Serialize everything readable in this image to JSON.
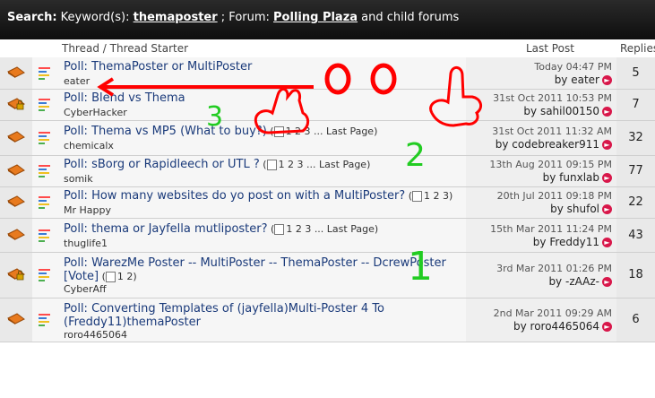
{
  "search": {
    "label": "Search:",
    "keyword_prefix": " Keyword(s): ",
    "keyword": "themaposter",
    "forum_prefix": " ; Forum: ",
    "forum": "Polling Plaza",
    "forum_suffix": " and child forums"
  },
  "columns": {
    "thread": "Thread / Thread Starter",
    "last_post": "Last Post",
    "replies": "Replies"
  },
  "threads": [
    {
      "title": "Poll: ThemaPoster or MultiPoster",
      "pages": "",
      "starter": "eater",
      "date": "Today 04:47 PM",
      "by_prefix": "by ",
      "by": "eater",
      "replies": "5",
      "icon": "closed-dark"
    },
    {
      "title": "Poll: Blend vs Thema",
      "pages": "",
      "starter": "CyberHacker",
      "date": "31st Oct 2011 10:53 PM",
      "by_prefix": "by ",
      "by": "sahil00150",
      "replies": "7",
      "icon": "closed-dark-lock"
    },
    {
      "title": "Poll: Thema vs MP5 (What to buy?)",
      "pages": "1 2 3 ... Last Page",
      "starter": "chemicalx",
      "date": "31st Oct 2011 11:32 AM",
      "by_prefix": "by ",
      "by": "codebreaker911",
      "replies": "32",
      "icon": "hot"
    },
    {
      "title": "Poll: sBorg or Rapidleech or UTL ?",
      "pages": "1 2 3 ... Last Page",
      "starter": "somik",
      "date": "13th Aug 2011 09:15 PM",
      "by_prefix": "by ",
      "by": "funxlab",
      "replies": "77",
      "icon": "hot"
    },
    {
      "title": "Poll: How many websites do yo post on with a MultiPoster?",
      "pages": "1 2 3",
      "starter": "Mr Happy",
      "date": "20th Jul 2011 09:18 PM",
      "by_prefix": "by ",
      "by": "shufol",
      "replies": "22",
      "icon": "hot"
    },
    {
      "title": "Poll: thema or Jayfella mutliposter?",
      "pages": "1 2 3 ... Last Page",
      "starter": "thuglife1",
      "date": "15th Mar 2011 11:24 PM",
      "by_prefix": "by ",
      "by": "Freddy11",
      "replies": "43",
      "icon": "hot"
    },
    {
      "title": "Poll: WarezMe Poster -- MultiPoster -- ThemaPoster -- DcrewPoster",
      "title2": "[Vote]",
      "pages": "1 2",
      "starter": "CyberAff",
      "date": "3rd Mar 2011 01:26 PM",
      "by_prefix": "by ",
      "by": "-zAAz-",
      "replies": "18",
      "icon": "hot-lock"
    },
    {
      "title": "Poll: Converting Templates of (jayfella)Multi-Poster 4 To",
      "title2": "(Freddy11)themaPoster",
      "pages": "",
      "starter": "roro4465064",
      "date": "2nd Mar 2011 09:29 AM",
      "by_prefix": "by ",
      "by": "roro4465064",
      "replies": "6",
      "icon": "hot"
    }
  ],
  "annotations": {
    "a1": "3",
    "a2": "2",
    "a3": "1"
  },
  "colors": {
    "accent": "#1a3a7a",
    "marker": "#ff0000",
    "marker_green": "#22cc22",
    "header_bg": "#111111"
  }
}
